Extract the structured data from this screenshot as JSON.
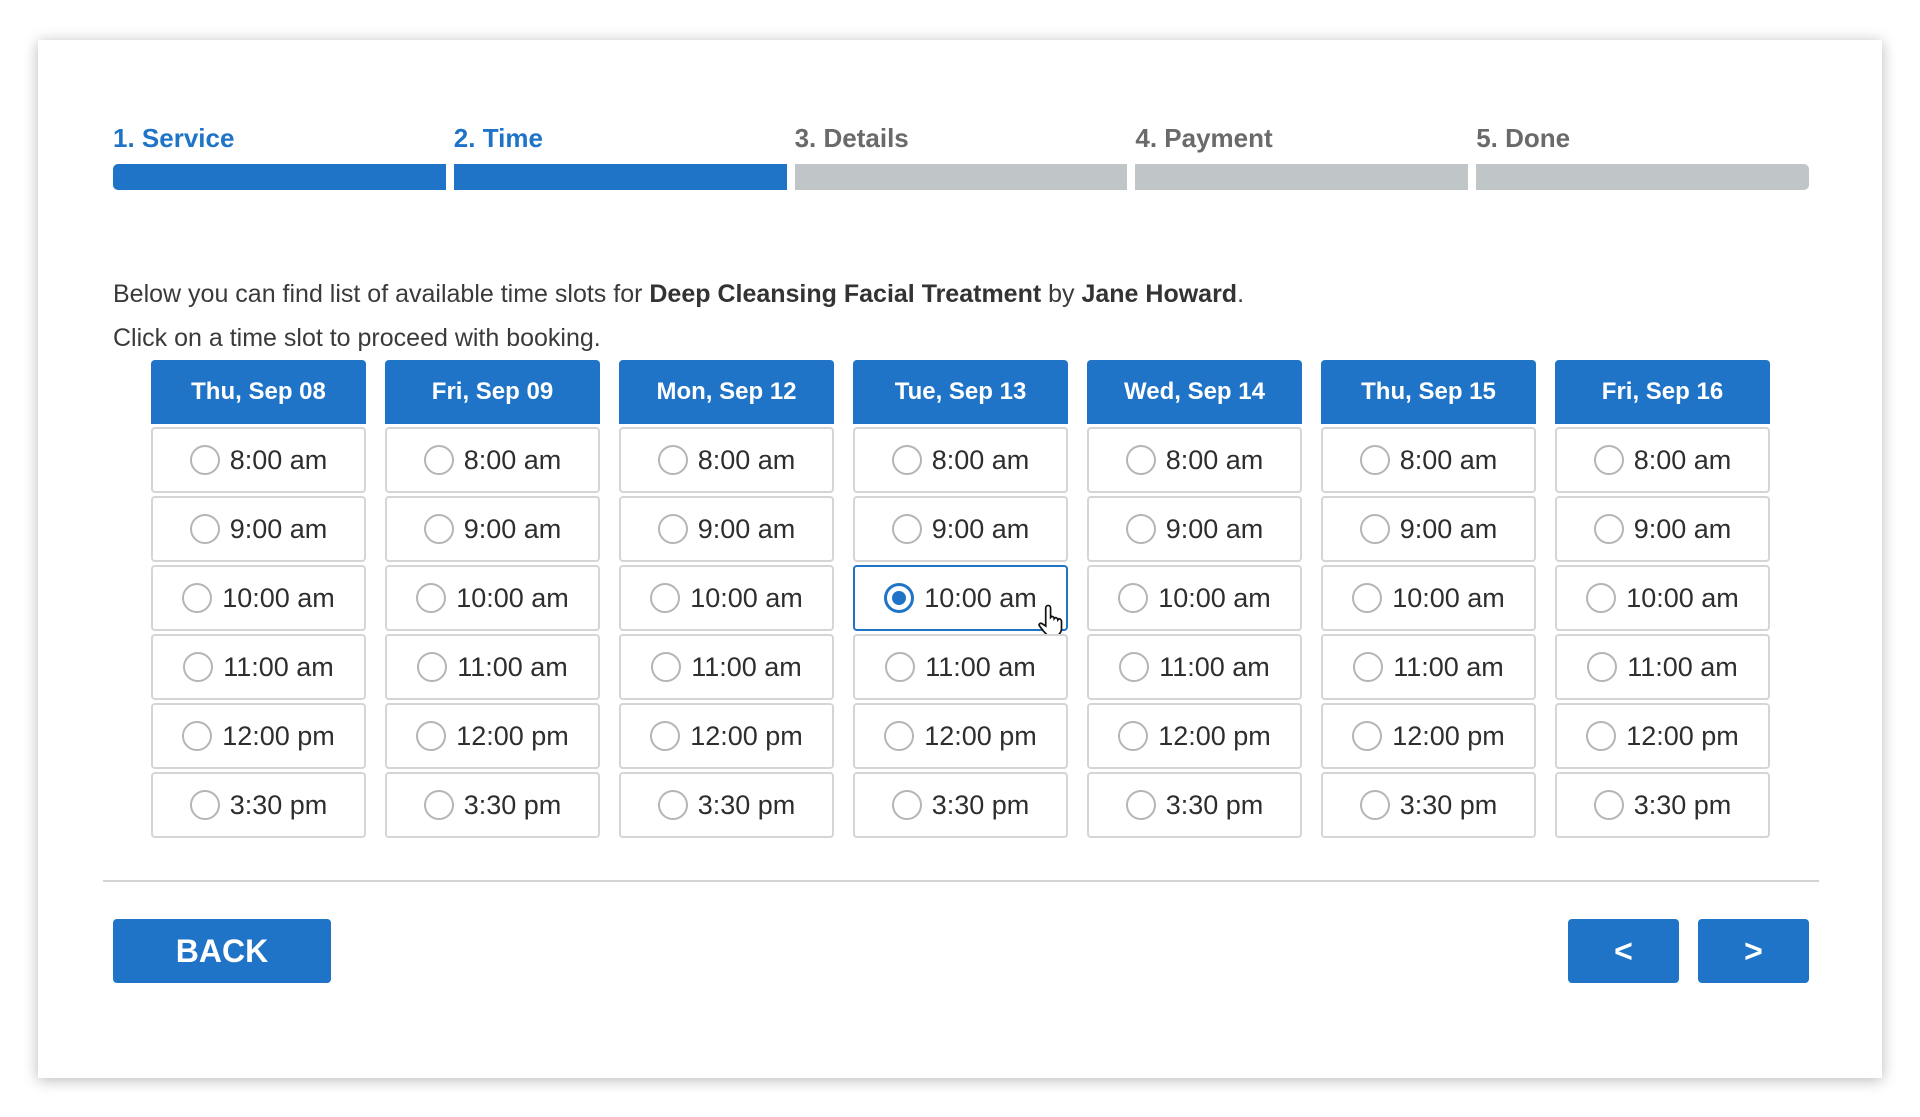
{
  "steps": [
    {
      "label": "1. Service",
      "active": true
    },
    {
      "label": "2. Time",
      "active": true
    },
    {
      "label": "3. Details",
      "active": false
    },
    {
      "label": "4. Payment",
      "active": false
    },
    {
      "label": "5. Done",
      "active": false
    }
  ],
  "intro": {
    "line1_prefix": "Below you can find list of available time slots for ",
    "service": "Deep Cleansing Facial Treatment",
    "by": " by ",
    "staff": "Jane Howard",
    "period": ".",
    "line2": "Click on a time slot to proceed with booking."
  },
  "days": [
    {
      "label": "Thu, Sep 08",
      "slots": [
        "8:00 am",
        "9:00 am",
        "10:00 am",
        "11:00 am",
        "12:00 pm",
        "3:30 pm"
      ]
    },
    {
      "label": "Fri, Sep 09",
      "slots": [
        "8:00 am",
        "9:00 am",
        "10:00 am",
        "11:00 am",
        "12:00 pm",
        "3:30 pm"
      ]
    },
    {
      "label": "Mon, Sep 12",
      "slots": [
        "8:00 am",
        "9:00 am",
        "10:00 am",
        "11:00 am",
        "12:00 pm",
        "3:30 pm"
      ]
    },
    {
      "label": "Tue, Sep 13",
      "slots": [
        "8:00 am",
        "9:00 am",
        "10:00 am",
        "11:00 am",
        "12:00 pm",
        "3:30 pm"
      ]
    },
    {
      "label": "Wed, Sep 14",
      "slots": [
        "8:00 am",
        "9:00 am",
        "10:00 am",
        "11:00 am",
        "12:00 pm",
        "3:30 pm"
      ]
    },
    {
      "label": "Thu, Sep 15",
      "slots": [
        "8:00 am",
        "9:00 am",
        "10:00 am",
        "11:00 am",
        "12:00 pm",
        "3:30 pm"
      ]
    },
    {
      "label": "Fri, Sep 16",
      "slots": [
        "8:00 am",
        "9:00 am",
        "10:00 am",
        "11:00 am",
        "12:00 pm",
        "3:30 pm"
      ]
    }
  ],
  "selected": {
    "day": 3,
    "slot": 2
  },
  "buttons": {
    "back": "BACK",
    "prev": "<",
    "next": ">"
  },
  "colors": {
    "accent": "#1f74c7",
    "inactive_bar": "#c0c5c8",
    "slot_border": "#d5d5d5"
  },
  "icons": {
    "cursor": "hand-pointer-icon",
    "radio": "radio-icon"
  }
}
